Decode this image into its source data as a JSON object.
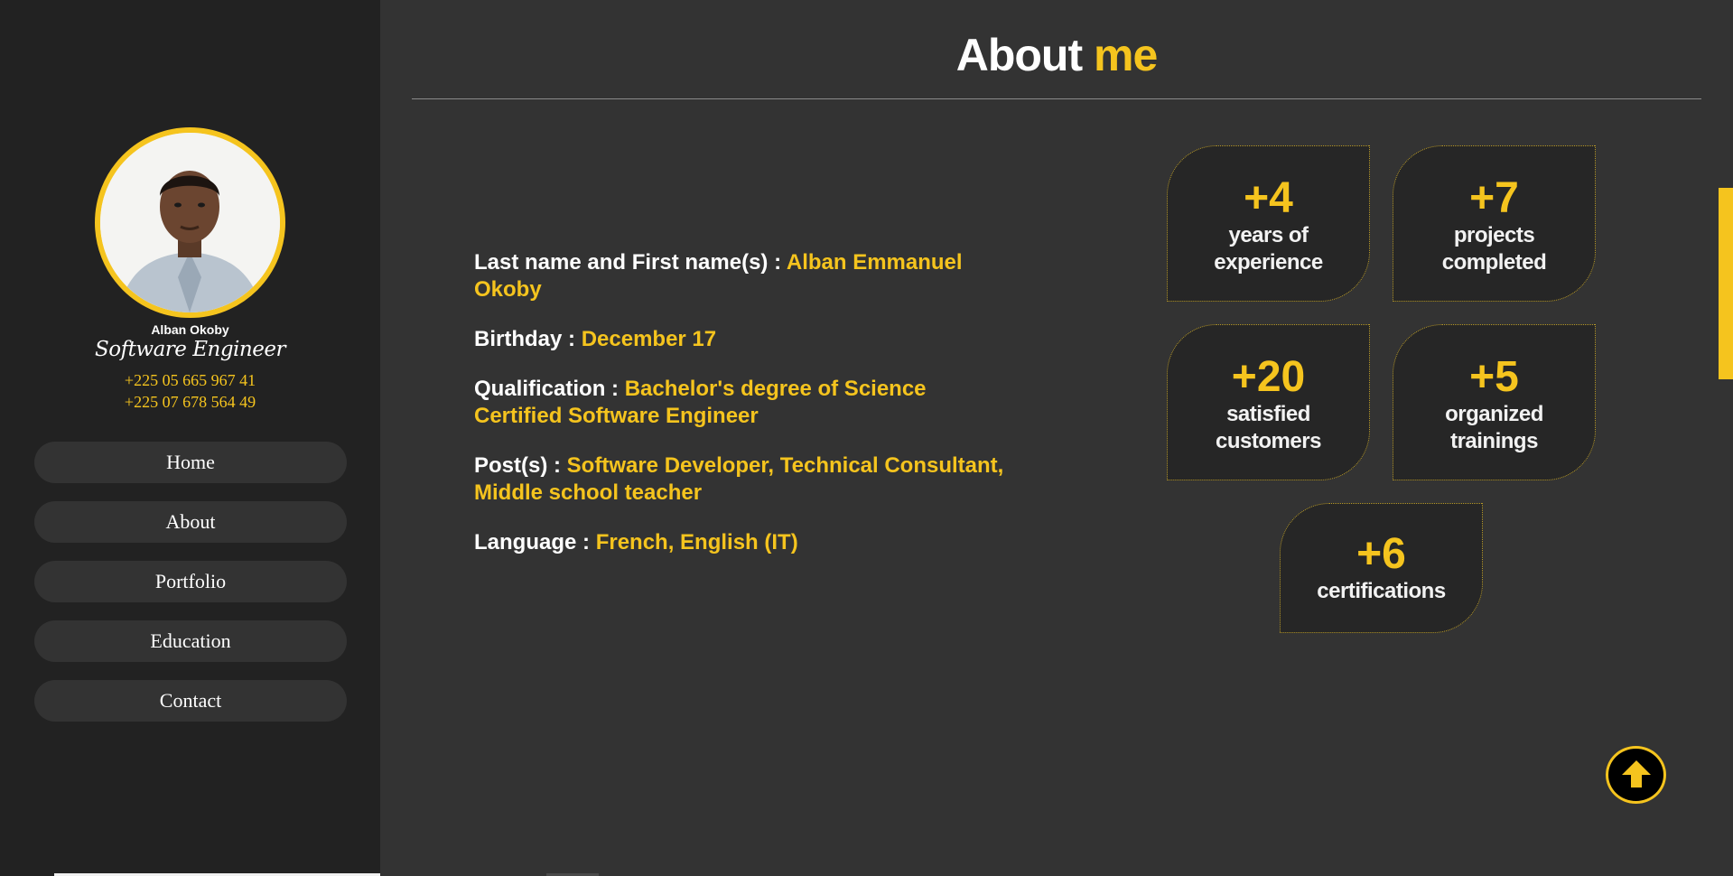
{
  "profile": {
    "name": "Alban Okoby",
    "role": "Software Engineer",
    "phones": [
      "+225 05 665 967 41",
      "+225 07 678 564 49"
    ]
  },
  "nav": {
    "items": [
      {
        "label": "Home"
      },
      {
        "label": "About"
      },
      {
        "label": "Portfolio"
      },
      {
        "label": "Education"
      },
      {
        "label": "Contact"
      }
    ]
  },
  "header": {
    "title_main": "About",
    "title_accent": "me"
  },
  "info": [
    {
      "label": "Last name and First name(s) :",
      "value": "Alban Emmanuel Okoby"
    },
    {
      "label": "Birthday :",
      "value": "December 17"
    },
    {
      "label": "Qualification :",
      "value": "Bachelor's degree of Science",
      "value2": "Certified Software Engineer"
    },
    {
      "label": "Post(s) :",
      "value": "Software Developer, Technical Consultant,",
      "value2": "Middle school teacher"
    },
    {
      "label": "Language :",
      "value": "French, English (IT)"
    }
  ],
  "stats": [
    {
      "number": "+4",
      "line1": "years of",
      "line2": "experience"
    },
    {
      "number": "+7",
      "line1": "projects",
      "line2": "completed"
    },
    {
      "number": "+20",
      "line1": "satisfied",
      "line2": "customers"
    },
    {
      "number": "+5",
      "line1": "organized",
      "line2": "trainings"
    },
    {
      "number": "+6",
      "line1": "certifications",
      "line2": ""
    }
  ],
  "icons": {
    "scroll_top": "arrow-up-icon",
    "avatar": "profile-photo"
  },
  "colors": {
    "accent": "#f5c41e",
    "sidebar_bg": "#222222",
    "main_bg": "#333333",
    "card_bg": "#262626"
  }
}
